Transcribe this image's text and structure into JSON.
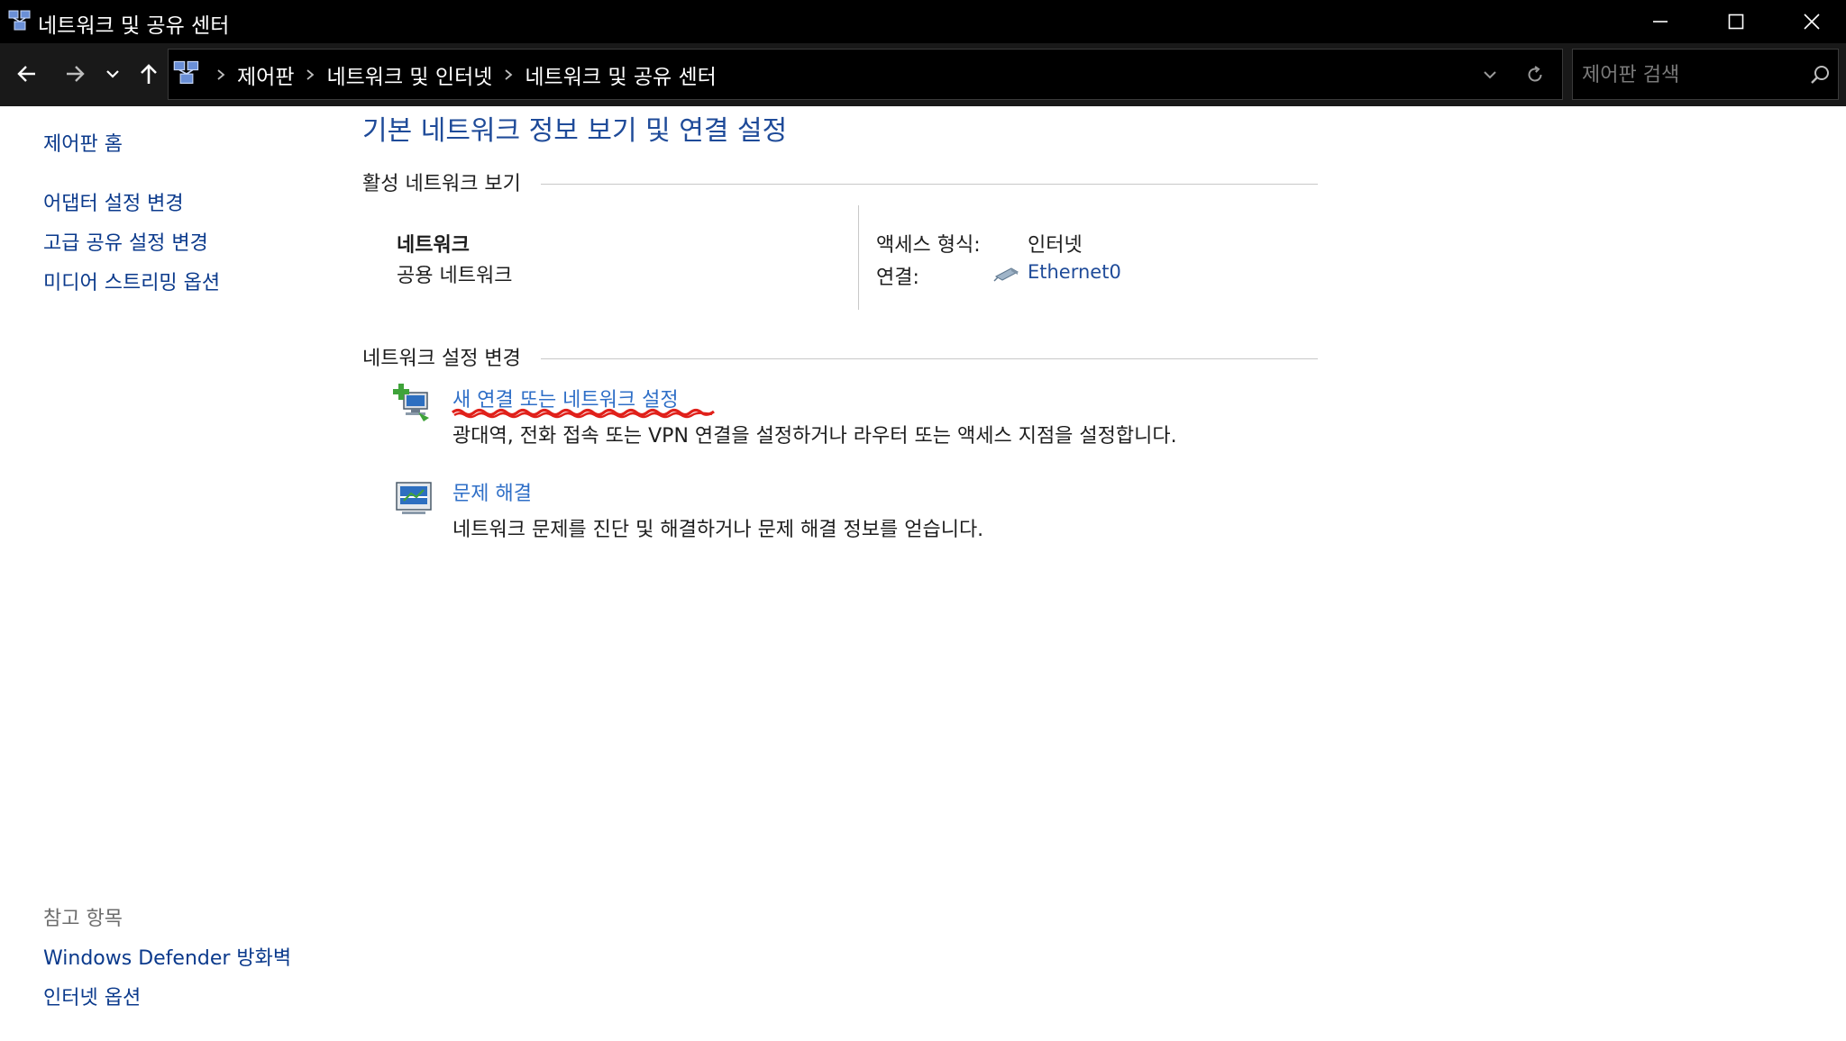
{
  "window": {
    "title": "네트워크 및 공유 센터"
  },
  "navigation": {
    "breadcrumbs": [
      "제어판",
      "네트워크 및 인터넷",
      "네트워크 및 공유 센터"
    ],
    "search_placeholder": "제어판 검색"
  },
  "sidebar": {
    "home": "제어판 홈",
    "items": [
      "어댑터 설정 변경",
      "고급 공유 설정 변경",
      "미디어 스트리밍 옵션"
    ],
    "see_also_heading": "참고 항목",
    "see_also": [
      "Windows Defender 방화벽",
      "인터넷 옵션"
    ]
  },
  "main": {
    "title": "기본 네트워크 정보 보기 및 연결 설정",
    "active_networks": {
      "heading": "활성 네트워크 보기",
      "network_name": "네트워크",
      "network_type": "공용 네트워크",
      "access_type_label": "액세스 형식:",
      "access_type_value": "인터넷",
      "connections_label": "연결:",
      "connection_name": "Ethernet0"
    },
    "change_settings": {
      "heading": "네트워크 설정 변경",
      "tasks": [
        {
          "label": "새 연결 또는 네트워크 설정",
          "description": "광대역, 전화 접속 또는 VPN 연결을 설정하거나 라우터 또는 액세스 지점을 설정합니다.",
          "icon": "network-add-icon"
        },
        {
          "label": "문제 해결",
          "description": "네트워크 문제를 진단 및 해결하거나 문제 해결 정보를 얻습니다.",
          "icon": "troubleshoot-icon"
        }
      ]
    }
  },
  "colors": {
    "titlebar": "#000000",
    "navbar": "#191919",
    "link": "#0b3a8c",
    "task_link": "#2f6fc7",
    "heading": "#1f4b99",
    "annotation": "#e0201a"
  }
}
